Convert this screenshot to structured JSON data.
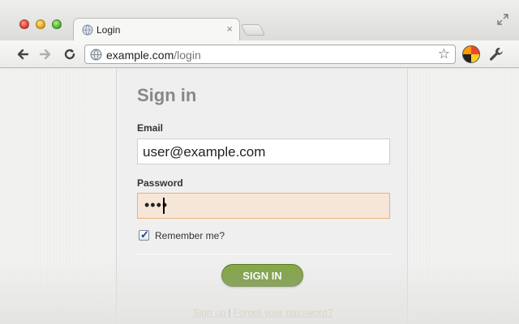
{
  "browser": {
    "tab_title": "Login",
    "tab_close": "×",
    "url_host": "example.com",
    "url_path": "/login"
  },
  "form": {
    "heading": "Sign in",
    "email_label": "Email",
    "email_value": "user@example.com",
    "password_label": "Password",
    "password_value": "••••",
    "remember_label": "Remember me?",
    "remember_checked": true,
    "submit_label": "SIGN IN",
    "signup_link": "Sign up",
    "separator": "|",
    "forgot_link": "Forgot your password?"
  },
  "colors": {
    "accent_button": "#6a9229",
    "password_highlight": "#f6e6d8",
    "heading_gray": "#888888"
  }
}
